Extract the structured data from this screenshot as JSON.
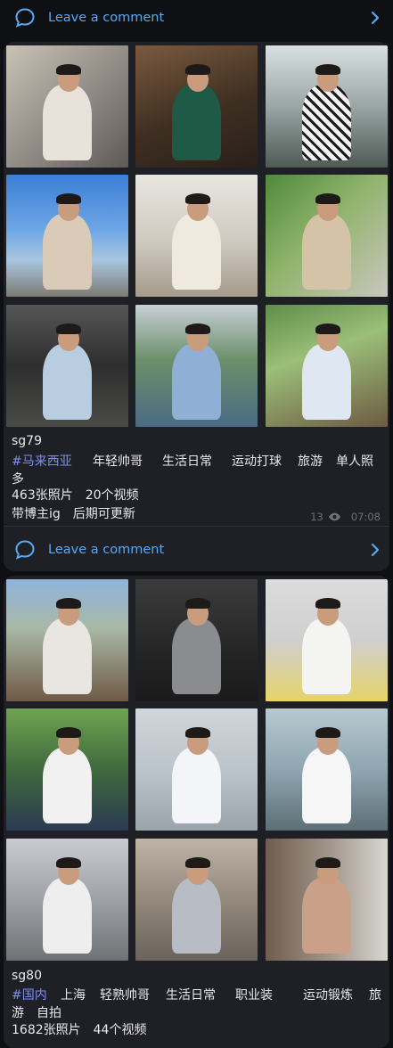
{
  "comment_label": "Leave a comment",
  "post1": {
    "name": "sg79",
    "tags": [
      "#马来西亚",
      "年轻帅哥",
      "生活日常",
      "运动打球",
      "旅游",
      "单人照"
    ],
    "tag_wrap": "多",
    "stats": "463张照片　20个视频",
    "extra": "带博主ig　后期可更新",
    "views": "13",
    "time": "07:08"
  },
  "post2": {
    "name": "sg80",
    "tags": [
      "#国内",
      "上海",
      "轻熟帅哥",
      "生活日常",
      "职业装",
      "运动锻炼",
      "旅"
    ],
    "tag_wrap": "游　自拍",
    "stats": "1682张照片　44个视频"
  },
  "colors": {
    "accent": "#5aa8f2",
    "hashtag": "#7b8ff0",
    "card": "#1f2026",
    "bg": "#0f1014"
  },
  "icons": {
    "comment": "comment-bubble-icon",
    "chevron": "chevron-right-icon",
    "views": "eye-icon"
  }
}
